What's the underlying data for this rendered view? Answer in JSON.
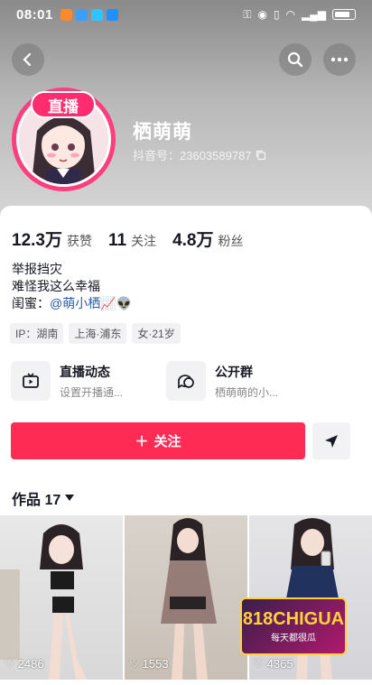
{
  "status_bar": {
    "time": "08:01"
  },
  "profile": {
    "nickname": "栖萌萌",
    "douyin_id": "抖音号：23603589787",
    "live_badge": "直播"
  },
  "stats": [
    {
      "value": "12.3万",
      "label": "获赞"
    },
    {
      "value": "11",
      "label": "关注"
    },
    {
      "value": "4.8万",
      "label": "粉丝"
    }
  ],
  "bio": {
    "line1": "举报挡灾",
    "line2": "难怪我这么幸福",
    "line3_prefix": "闺蜜：",
    "mention": "@萌小栖",
    "emoji": "📈👽"
  },
  "tags": [
    "IP：湖南",
    "上海·浦东",
    "女·21岁"
  ],
  "features": {
    "live": {
      "title": "直播动态",
      "subtitle": "设置开播通..."
    },
    "group": {
      "title": "公开群",
      "subtitle": "栖萌萌的小..."
    }
  },
  "follow_button": {
    "label": "关注"
  },
  "works": {
    "label": "作品 17"
  },
  "videos": [
    {
      "likes": "2486"
    },
    {
      "likes": "1553"
    },
    {
      "likes": "4365"
    }
  ],
  "watermark": {
    "brand": "818CHIGUA",
    "tagline": "每天都很瓜"
  },
  "colors": {
    "accent": "#fe2c55",
    "live": "#ff2d6f",
    "mention": "#2a5ba8"
  }
}
